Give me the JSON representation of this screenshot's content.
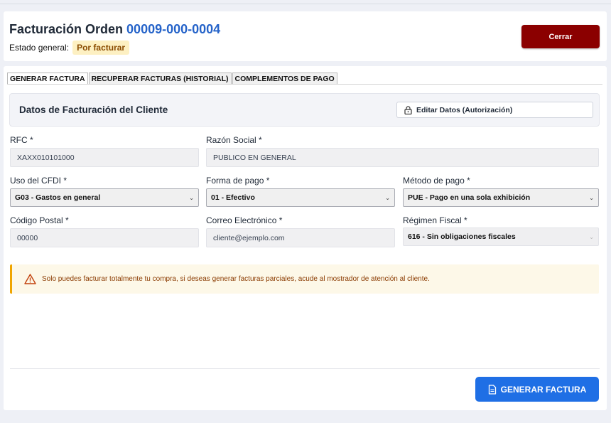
{
  "header": {
    "title_prefix": "Facturación Orden",
    "order_number": "00009-000-0004",
    "status_label": "Estado general:",
    "status_value": "Por facturar",
    "close_label": "Cerrar"
  },
  "tabs": [
    {
      "label": "GENERAR FACTURA",
      "active": true
    },
    {
      "label": "RECUPERAR FACTURAS (HISTORIAL)",
      "active": false
    },
    {
      "label": "COMPLEMENTOS DE PAGO",
      "active": false
    }
  ],
  "section": {
    "title": "Datos de Facturación del Cliente",
    "edit_label": "Editar Datos (Autorización)",
    "edit_icon": "lock-icon"
  },
  "fields": {
    "rfc": {
      "label": "RFC *",
      "value": "XAXX010101000"
    },
    "razon_social": {
      "label": "Razón Social *",
      "value": "PUBLICO EN GENERAL"
    },
    "uso_cfdi": {
      "label": "Uso del CFDI *",
      "value": "G03 - Gastos en general"
    },
    "forma_pago": {
      "label": "Forma de pago *",
      "value": "01 - Efectivo"
    },
    "metodo_pago": {
      "label": "Método de pago *",
      "value": "PUE - Pago en una sola exhibición"
    },
    "codigo_postal": {
      "label": "Código Postal *",
      "value": "00000"
    },
    "correo": {
      "label": "Correo Electrónico *",
      "value": "cliente@ejemplo.com"
    },
    "regimen_fiscal": {
      "label": "Régimen Fiscal *",
      "value": "616 - Sin obligaciones fiscales"
    }
  },
  "alert": {
    "icon": "warning-icon",
    "text": "Solo puedes facturar totalmente tu compra, si deseas generar facturas parciales, acude al mostrador de atención al cliente."
  },
  "actions": {
    "generate_label": "GENERAR FACTURA",
    "generate_icon": "document-icon"
  },
  "colors": {
    "accent": "#1f6fe5",
    "order_number": "#2563c9",
    "close_button": "#8b0000",
    "status_badge_bg": "#fdf0c2",
    "alert_border": "#f0a500"
  }
}
